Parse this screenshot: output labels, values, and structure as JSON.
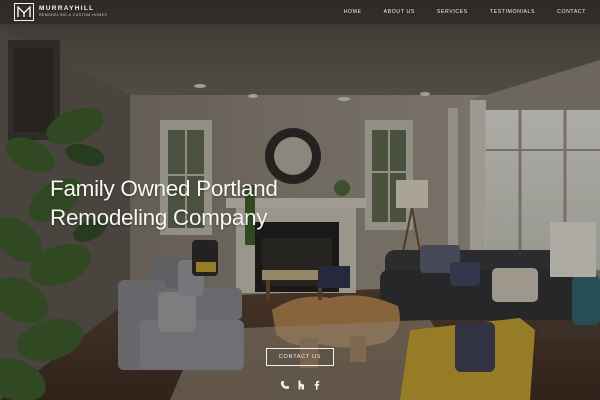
{
  "brand": {
    "name": "MURRAYHILL",
    "tagline": "REMODELING & CUSTOM HOMES"
  },
  "nav": {
    "items": [
      "HOME",
      "ABOUT US",
      "SERVICES",
      "TESTIMONIALS",
      "CONTACT"
    ]
  },
  "hero": {
    "headline_line1": "Family Owned Portland",
    "headline_line2": "Remodeling Company",
    "cta_label": "CONTACT US"
  },
  "social": {
    "icons": [
      "phone-icon",
      "houzz-icon",
      "facebook-icon"
    ]
  },
  "colors": {
    "nav_bg": "#23211f",
    "text": "#f5f3ef",
    "wall": "#8a8276",
    "sofa": "#3a3b40",
    "accent_yellow": "#c9a532"
  }
}
